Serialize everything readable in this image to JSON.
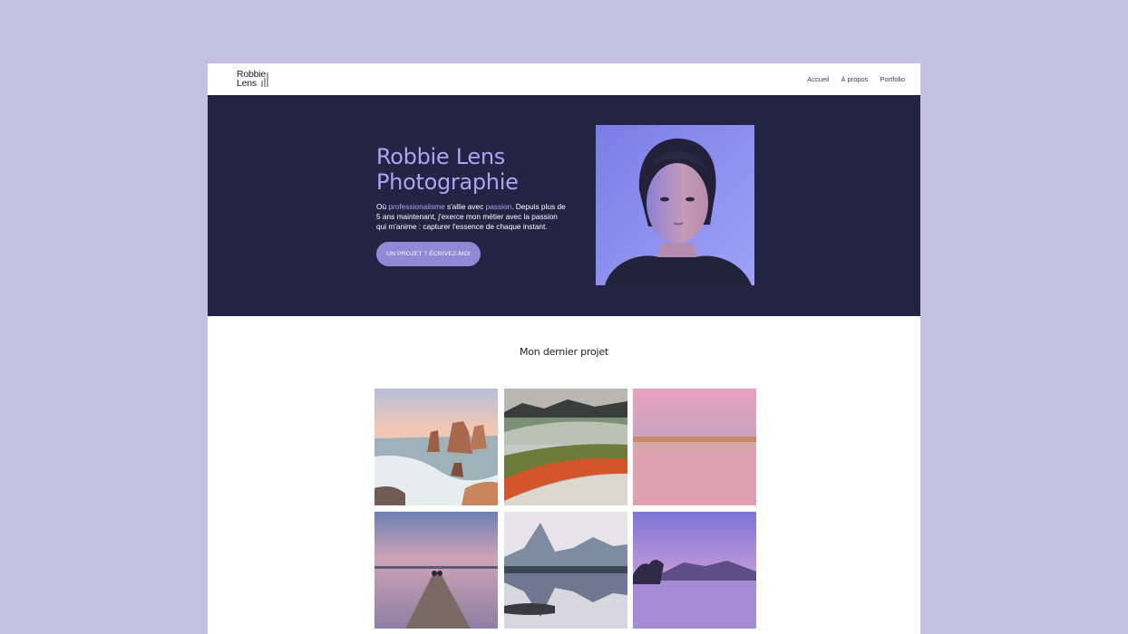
{
  "header": {
    "logo_line1": "Robbie",
    "logo_line2": "Lens",
    "nav": [
      "Accueil",
      "À propos",
      "Portfolio"
    ]
  },
  "hero": {
    "title_line1": "Robbie Lens",
    "title_line2": "Photographie",
    "text_before": "Où ",
    "highlight1": "professionalisme",
    "text_middle": " s'allie avec ",
    "highlight2": "passion",
    "text_after": ". Depuis plus de 5 ans maintenant, j'exerce mon métier avec la passion qui m'anime : capturer l'essence de chaque instant.",
    "cta_label": "UN PROJET ? ÉCRIVEZ-MOI"
  },
  "gallery": {
    "title": "Mon dernier projet",
    "photos": [
      "coastal-rock-stacks",
      "geothermal-hot-spring",
      "pink-lake-horizon",
      "wooden-jetty-sunset",
      "mountain-reflection",
      "lone-tree-lake"
    ]
  },
  "colors": {
    "page_background": "#c5c1e3",
    "hero_background": "#232444",
    "accent": "#a9a5f0",
    "button": "#8f89d6"
  }
}
